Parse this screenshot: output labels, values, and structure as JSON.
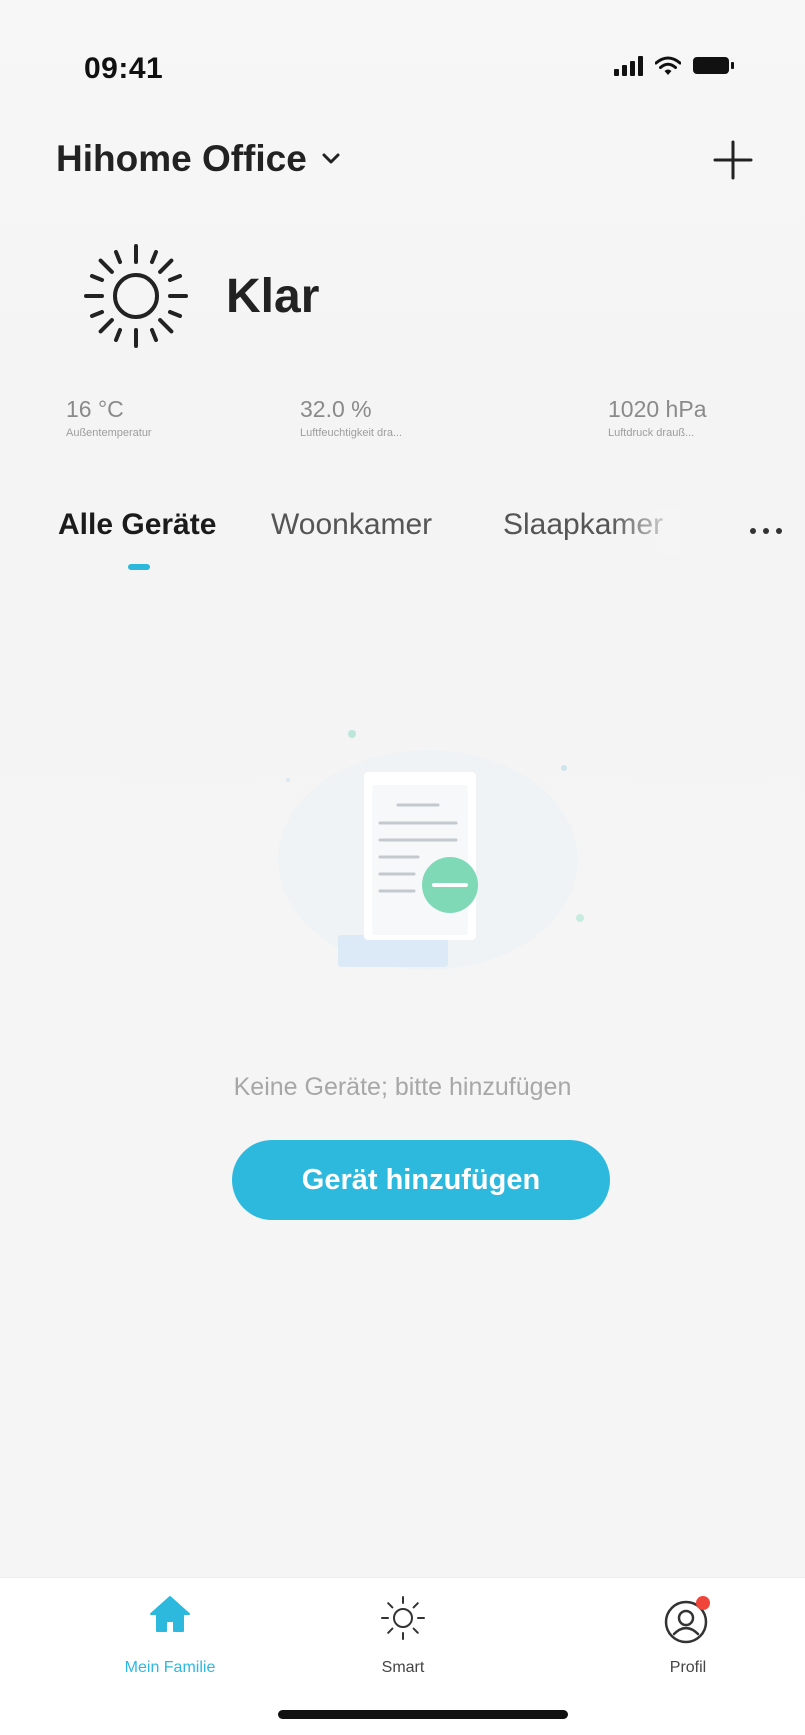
{
  "status_bar": {
    "time": "09:41"
  },
  "header": {
    "home_name": "Hihome Office"
  },
  "weather": {
    "condition": "Klar",
    "metrics": [
      {
        "value": "16 °C",
        "label": "Außentemperatur"
      },
      {
        "value": "32.0 %",
        "label": "Luftfeuchtigkeit dra..."
      },
      {
        "value": "1020 hPa",
        "label": "Luftdruck drauß..."
      }
    ]
  },
  "tabs": [
    {
      "label": "Alle Geräte",
      "active": true
    },
    {
      "label": "Woonkamer",
      "active": false
    },
    {
      "label": "Slaapkamer",
      "active": false
    }
  ],
  "empty_state": {
    "message": "Keine Geräte; bitte hinzufügen",
    "button_label": "Gerät hinzufügen"
  },
  "bottom_nav": [
    {
      "label": "Mein Familie",
      "icon": "home-icon",
      "active": true
    },
    {
      "label": "Smart",
      "icon": "sun-icon",
      "active": false
    },
    {
      "label": "Profil",
      "icon": "profile-icon",
      "active": false,
      "badge": true
    }
  ],
  "colors": {
    "accent": "#2db9de",
    "badge": "#f0453a",
    "illustration_green": "#7fd9b7"
  }
}
